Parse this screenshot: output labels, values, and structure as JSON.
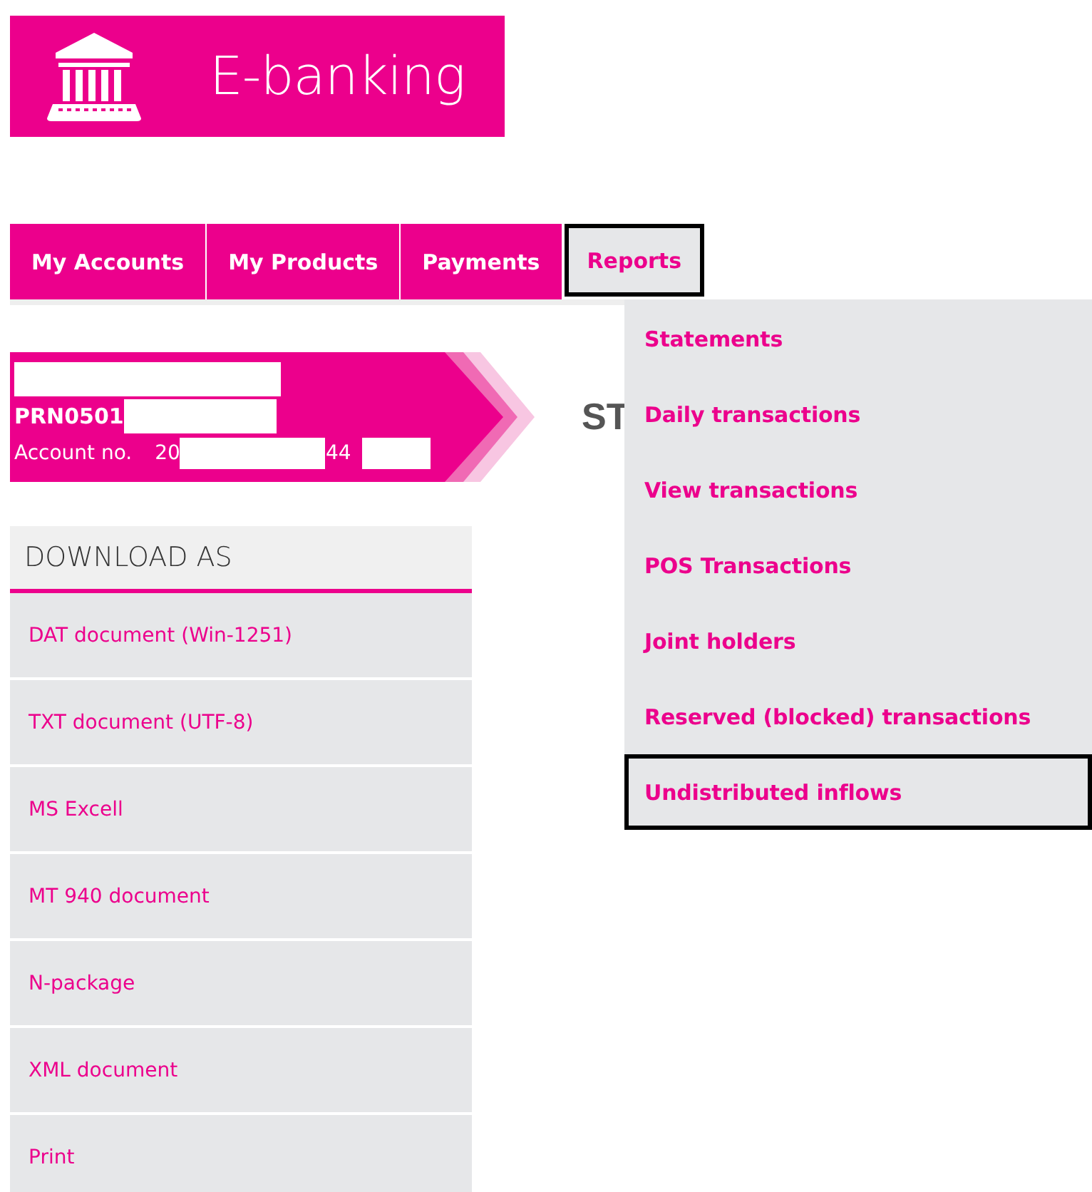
{
  "logo": {
    "title": "E-banking"
  },
  "nav": {
    "tabs": [
      {
        "label": "My Accounts",
        "selected": false
      },
      {
        "label": "My Products",
        "selected": false
      },
      {
        "label": "Payments",
        "selected": false
      },
      {
        "label": "Reports",
        "selected": true
      }
    ]
  },
  "reports_menu": {
    "items": [
      {
        "label": "Statements",
        "selected": false
      },
      {
        "label": "Daily transactions",
        "selected": false
      },
      {
        "label": "View transactions",
        "selected": false
      },
      {
        "label": "POS Transactions",
        "selected": false
      },
      {
        "label": "Joint holders",
        "selected": false
      },
      {
        "label": "Reserved (blocked) transactions",
        "selected": false
      },
      {
        "label": "Undistributed inflows",
        "selected": true
      }
    ]
  },
  "account": {
    "client_code": "PRN0501",
    "account_label": "Account no.",
    "account_start": "20",
    "account_end": "44"
  },
  "page_title": "ST",
  "download": {
    "title": "DOWNLOAD AS",
    "items": [
      "DAT document (Win-1251)",
      "TXT document (UTF-8)",
      "MS Excell",
      "MT 940 document",
      "N-package",
      "XML document",
      "Print"
    ]
  }
}
